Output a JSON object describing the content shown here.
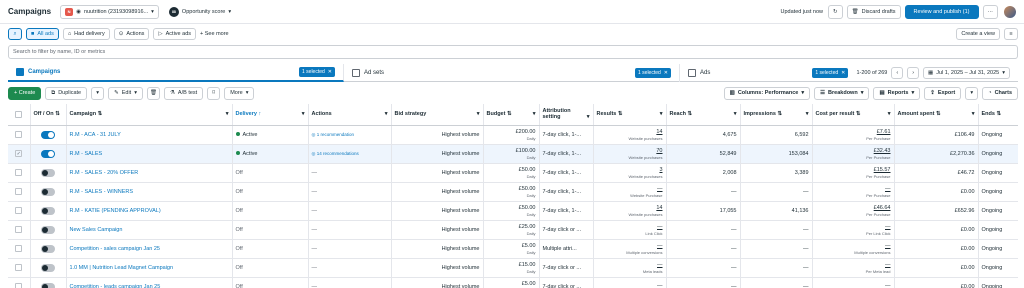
{
  "header": {
    "title": "Campaigns",
    "account_logo": "N",
    "account_name": "nuutrition (23193098916...",
    "opportunity_label": "Opportunity score",
    "opportunity_value": "88",
    "updated": "Updated just now",
    "discard_label": "Discard drafts",
    "publish_label": "Review and publish (1)",
    "more_label": "···"
  },
  "filters": {
    "all_ads": "All ads",
    "had_delivery": "Had delivery",
    "actions": "Actions",
    "active_ads": "Active ads",
    "see_more": "+ See more",
    "create_view": "Create a view"
  },
  "search": {
    "placeholder": "Search to filter by name, ID or metrics"
  },
  "tabs": [
    {
      "label": "Campaigns",
      "selected": "1 selected"
    },
    {
      "label": "Ad sets",
      "selected": "1 selected"
    },
    {
      "label": "Ads",
      "selected": "1 selected"
    }
  ],
  "range": {
    "count": "1-200 of 269",
    "dates": "Jul 1, 2025 – Jul 31, 2025"
  },
  "toolbar": {
    "create": "+ Create",
    "duplicate": "Duplicate",
    "edit": "Edit",
    "ab_test": "A/B test",
    "more": "More",
    "columns": "Columns: Performance",
    "breakdown": "Breakdown",
    "reports": "Reports",
    "export": "Export",
    "charts": "Charts"
  },
  "columns": [
    "Off / On",
    "Campaign",
    "Delivery",
    "Actions",
    "Bid strategy",
    "Budget",
    "Attribution setting",
    "Results",
    "Reach",
    "Impressions",
    "Cost per result",
    "Amount spent",
    "Ends"
  ],
  "rows": [
    {
      "on": true,
      "selected": false,
      "name": "R.M - ACA - 31 JULY",
      "delivery": "Active",
      "active": true,
      "actions": "1 recommendation",
      "bid": "Highest volume",
      "budget": "£200.00",
      "budget_sub": "Daily",
      "attr": "7-day click, 1-...",
      "results": "14",
      "results_sub": "Website purchases",
      "reach": "4,675",
      "impr": "6,592",
      "cpr": "£7.61",
      "cpr_sub": "Per Purchase",
      "spent": "£106.49",
      "ends": "Ongoing"
    },
    {
      "on": true,
      "selected": true,
      "name": "R.M - SALES",
      "delivery": "Active",
      "active": true,
      "actions": "14 recommendations",
      "bid": "Highest volume",
      "budget": "£100.00",
      "budget_sub": "Daily",
      "attr": "7-day click, 1-...",
      "results": "70",
      "results_sub": "Website purchases",
      "reach": "52,849",
      "impr": "153,084",
      "cpr": "£32.43",
      "cpr_sub": "Per Purchase",
      "spent": "£2,270.36",
      "ends": "Ongoing"
    },
    {
      "on": false,
      "selected": false,
      "name": "R.M - SALES - 20% OFFER",
      "delivery": "Off",
      "active": false,
      "actions": "—",
      "bid": "Highest volume",
      "budget": "£50.00",
      "budget_sub": "Daily",
      "attr": "7-day click, 1-...",
      "results": "3",
      "results_sub": "Website purchases",
      "reach": "2,008",
      "impr": "3,389",
      "cpr": "£15.57",
      "cpr_sub": "Per Purchase",
      "spent": "£46.72",
      "ends": "Ongoing"
    },
    {
      "on": false,
      "selected": false,
      "name": "R.M - SALES - WINNERS",
      "delivery": "Off",
      "active": false,
      "actions": "—",
      "bid": "Highest volume",
      "budget": "£50.00",
      "budget_sub": "Daily",
      "attr": "7-day click, 1-...",
      "results": "—",
      "results_sub": "Website Purchase",
      "reach": "—",
      "impr": "—",
      "cpr": "—",
      "cpr_sub": "Per Purchase",
      "spent": "£0.00",
      "ends": "Ongoing"
    },
    {
      "on": false,
      "selected": false,
      "name": "R.M - KATIE (PENDING APPROVAL)",
      "delivery": "Off",
      "active": false,
      "actions": "—",
      "bid": "Highest volume",
      "budget": "£50.00",
      "budget_sub": "Daily",
      "attr": "7-day click, 1-...",
      "results": "14",
      "results_sub": "Website purchases",
      "reach": "17,055",
      "impr": "41,136",
      "cpr": "£46.64",
      "cpr_sub": "Per Purchase",
      "spent": "£652.96",
      "ends": "Ongoing"
    },
    {
      "on": false,
      "selected": false,
      "name": "New Sales Campaign",
      "delivery": "Off",
      "active": false,
      "actions": "—",
      "bid": "Highest volume",
      "budget": "£25.00",
      "budget_sub": "Daily",
      "attr": "7-day click or ...",
      "results": "—",
      "results_sub": "Link Click",
      "reach": "—",
      "impr": "—",
      "cpr": "—",
      "cpr_sub": "Per Link Click",
      "spent": "£0.00",
      "ends": "Ongoing"
    },
    {
      "on": false,
      "selected": false,
      "name": "Competition - sales campaign Jan 25",
      "delivery": "Off",
      "active": false,
      "actions": "—",
      "bid": "Highest volume",
      "budget": "£5.00",
      "budget_sub": "Daily",
      "attr": "Multiple attri...",
      "results": "—",
      "results_sub": "Multiple conversions",
      "reach": "—",
      "impr": "—",
      "cpr": "—",
      "cpr_sub": "Multiple conversions",
      "spent": "£0.00",
      "ends": "Ongoing"
    },
    {
      "on": false,
      "selected": false,
      "name": "1.0 MM | Nutrition Lead Magnet Campaign",
      "delivery": "Off",
      "active": false,
      "actions": "—",
      "bid": "Highest volume",
      "budget": "£15.00",
      "budget_sub": "Daily",
      "attr": "7-day click or ...",
      "results": "—",
      "results_sub": "Meta leads",
      "reach": "—",
      "impr": "—",
      "cpr": "—",
      "cpr_sub": "Per Meta lead",
      "spent": "£0.00",
      "ends": "Ongoing"
    },
    {
      "on": false,
      "selected": false,
      "name": "Competition - leads campaign Jan 25",
      "delivery": "Off",
      "active": false,
      "actions": "—",
      "bid": "Highest volume",
      "budget": "£5.00",
      "budget_sub": "Daily",
      "attr": "7-day click or ...",
      "results": "—",
      "results_sub": "",
      "reach": "—",
      "impr": "—",
      "cpr": "—",
      "cpr_sub": "",
      "spent": "£0.00",
      "ends": "Ongoing"
    }
  ]
}
